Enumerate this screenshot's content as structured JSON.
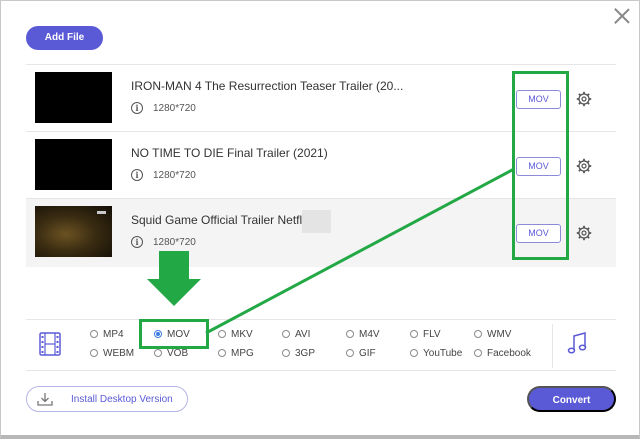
{
  "toolbar": {
    "add_file_label": "Add File"
  },
  "files": [
    {
      "title": "IRON-MAN 4 The Resurrection Teaser Trailer (20...",
      "resolution": "1280*720",
      "format": "MOV",
      "info_glyph": "i"
    },
    {
      "title": "NO TIME TO DIE Final Trailer (2021)",
      "resolution": "1280*720",
      "format": "MOV",
      "info_glyph": "i"
    },
    {
      "title": "Squid Game Official Trailer Netflix",
      "resolution": "1280*720",
      "format": "MOV",
      "info_glyph": "i"
    }
  ],
  "formats": {
    "row1": [
      "MP4",
      "MOV",
      "MKV",
      "AVI",
      "M4V",
      "FLV",
      "WMV"
    ],
    "row2": [
      "WEBM",
      "VOB",
      "MPG",
      "3GP",
      "GIF",
      "YouTube",
      "Facebook"
    ],
    "selected": "MOV"
  },
  "footer": {
    "install_label": "Install Desktop Version",
    "convert_label": "Convert"
  },
  "icons": {
    "close": "close-icon",
    "info": "info-icon",
    "gear": "gear-icon",
    "video_tab": "film-icon",
    "audio_tab": "music-note-icon",
    "download": "download-icon"
  },
  "colors": {
    "accent": "#5b5ad6",
    "annotation": "#22a845",
    "radio_selected": "#3b7de0"
  }
}
